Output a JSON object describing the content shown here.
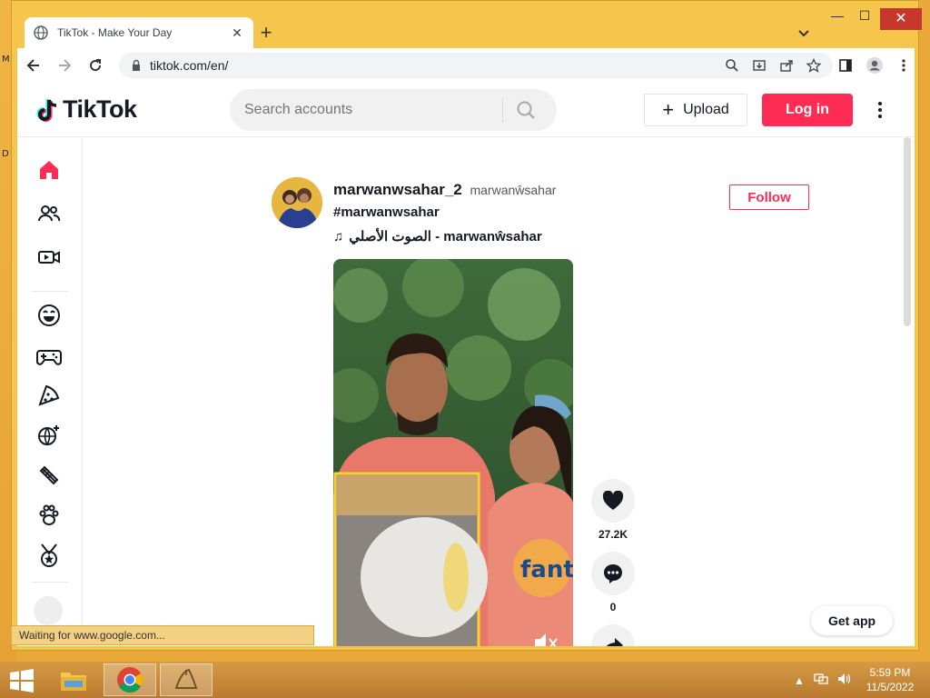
{
  "desktop": {
    "letters": [
      "M",
      "D"
    ]
  },
  "browser": {
    "tab_title": "TikTok - Make Your Day",
    "tab_close": "✕",
    "new_tab": "+",
    "url": "tiktok.com/en/",
    "window_controls": {
      "minimize": "—",
      "maximize": "☐",
      "close": "✕"
    },
    "status_text": "Waiting for www.google.com..."
  },
  "tiktok": {
    "logo_text": "TikTok",
    "search_placeholder": "Search accounts",
    "upload_label": "Upload",
    "upload_plus": "+",
    "login_label": "Log in",
    "sidebar_icons": [
      "home-icon",
      "following-icon",
      "live-icon",
      "comedy-icon",
      "gaming-icon",
      "food-icon",
      "dance-icon",
      "beauty-icon",
      "animals-icon",
      "sports-icon"
    ],
    "post": {
      "username": "marwanwsahar_2",
      "nickname": "marwanŵsahar",
      "caption": "#marwanwsahar",
      "music_note": "♫",
      "music": "الصوت الأصلي - marwanŵsahar",
      "follow_label": "Follow",
      "likes": "27.2K",
      "comments": "0"
    },
    "get_app_label": "Get app",
    "accent_color": "#fe2c55"
  },
  "taskbar": {
    "time": "5:59 PM",
    "date": "11/5/2022"
  }
}
